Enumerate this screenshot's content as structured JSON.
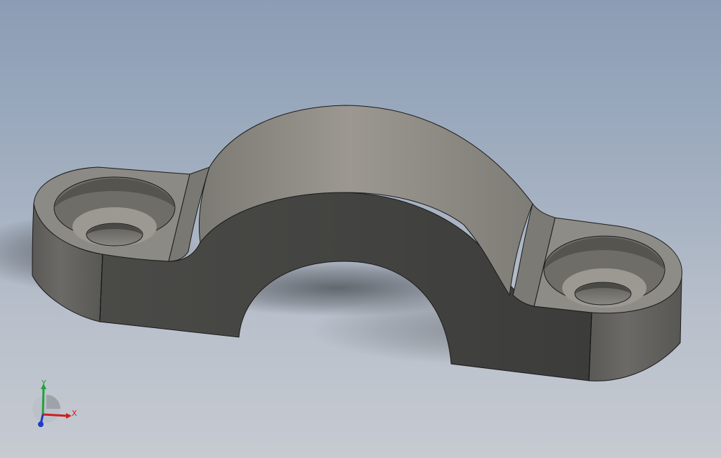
{
  "viewport": {
    "background_top": "#8b9db5",
    "background_bottom": "#c6cad1"
  },
  "model": {
    "part": "pipe-clamp",
    "colors": {
      "top_face": "#8f8d87",
      "front_face": "#3f3f3d",
      "dark_face": "#353533",
      "edge": "#1a1a1a"
    }
  },
  "triad": {
    "x_label": "X",
    "y_label": "Y",
    "x_color": "#cc1f1f",
    "y_color": "#1fa33a",
    "z_color": "#1f3acc"
  }
}
